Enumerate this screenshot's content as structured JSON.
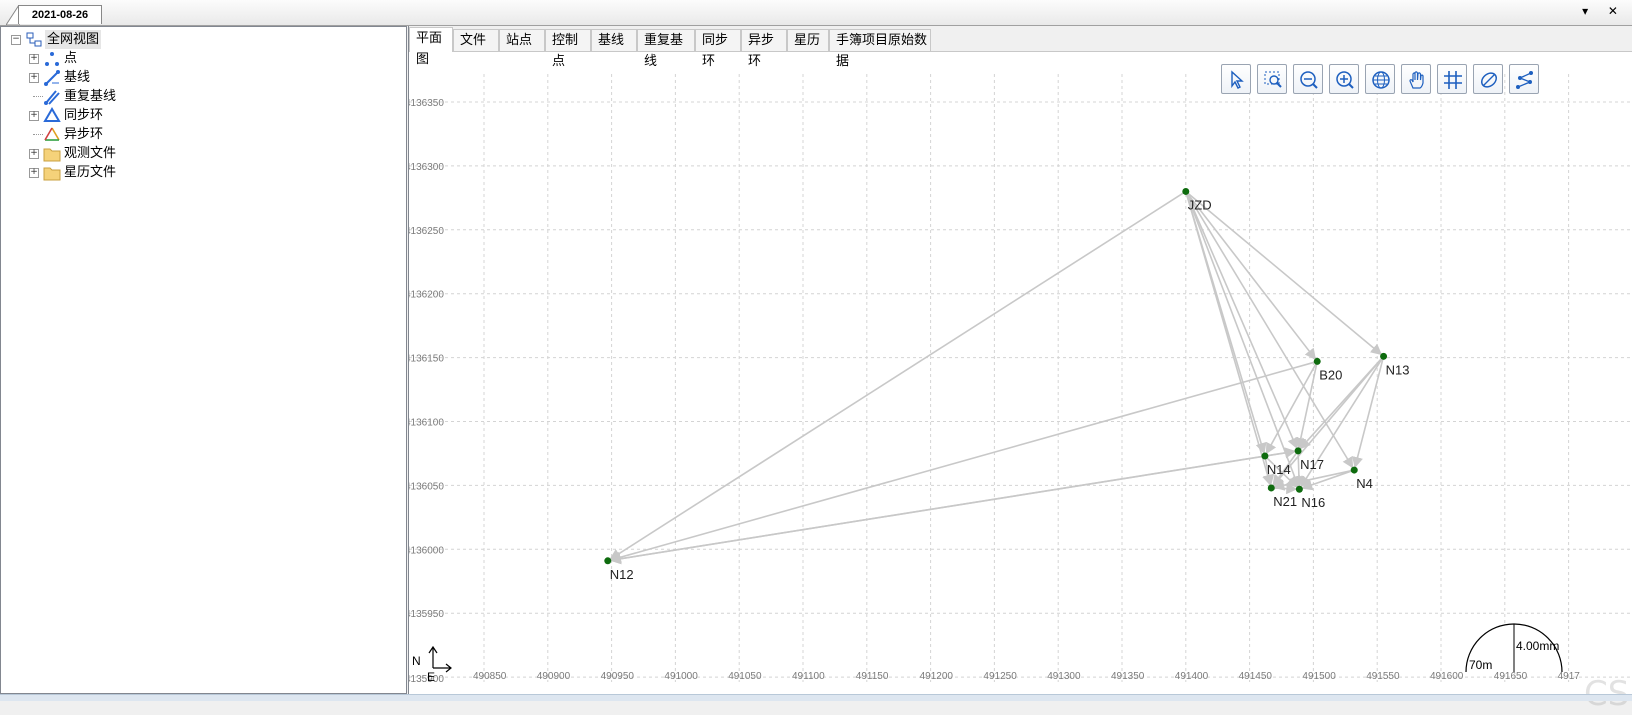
{
  "window": {
    "date_tab": "2021-08-26",
    "controls": "▾ ✕"
  },
  "sidebar": {
    "root_label": "全网视图",
    "items": [
      {
        "label": "点",
        "icon": "points-icon",
        "expandable": true
      },
      {
        "label": "基线",
        "icon": "baseline-icon",
        "expandable": true
      },
      {
        "label": "重复基线",
        "icon": "repeat-baseline-icon",
        "expandable": false
      },
      {
        "label": "同步环",
        "icon": "sync-loop-icon",
        "expandable": true
      },
      {
        "label": "异步环",
        "icon": "async-loop-icon",
        "expandable": false
      },
      {
        "label": "观测文件",
        "icon": "folder-icon",
        "expandable": true
      },
      {
        "label": "星历文件",
        "icon": "folder-icon",
        "expandable": true
      }
    ]
  },
  "tabs": [
    "平面图",
    "文件",
    "站点",
    "控制点",
    "基线",
    "重复基线",
    "同步环",
    "异步环",
    "星历",
    "手簿项目原始数据"
  ],
  "active_tab": "平面图",
  "toolbar": [
    "select-icon",
    "zoom-window-icon",
    "zoom-out-icon",
    "zoom-in-icon",
    "globe-icon",
    "pan-hand-icon",
    "grid-icon",
    "ellipse-icon",
    "network-icon"
  ],
  "map": {
    "x_ticks": [
      "490850",
      "490900",
      "490950",
      "491000",
      "491050",
      "491100",
      "491150",
      "491200",
      "491250",
      "491300",
      "491350",
      "491400",
      "491450",
      "491500",
      "491550",
      "491600",
      "491650",
      "4917"
    ],
    "y_ticks": [
      "4136350",
      "4136300",
      "4136250",
      "4136200",
      "4136150",
      "4136100",
      "4136050",
      "4136000",
      "4135950",
      "4135900"
    ],
    "points": [
      {
        "name": "JZD",
        "x": 491400,
        "y": 4136280
      },
      {
        "name": "N13",
        "x": 491555,
        "y": 4136151
      },
      {
        "name": "B20",
        "x": 491503,
        "y": 4136147
      },
      {
        "name": "N17",
        "x": 491488,
        "y": 4136077
      },
      {
        "name": "N14",
        "x": 491462,
        "y": 4136073
      },
      {
        "name": "N4",
        "x": 491532,
        "y": 4136062
      },
      {
        "name": "N21",
        "x": 491467,
        "y": 4136048
      },
      {
        "name": "N16",
        "x": 491489,
        "y": 4136047
      },
      {
        "name": "N12",
        "x": 490947,
        "y": 4135991
      }
    ],
    "baselines": [
      [
        "JZD",
        "N12"
      ],
      [
        "JZD",
        "N13"
      ],
      [
        "JZD",
        "B20"
      ],
      [
        "JZD",
        "N17"
      ],
      [
        "JZD",
        "N14"
      ],
      [
        "JZD",
        "N4"
      ],
      [
        "JZD",
        "N21"
      ],
      [
        "JZD",
        "N16"
      ],
      [
        "B20",
        "N12"
      ],
      [
        "N14",
        "N12"
      ],
      [
        "N17",
        "N12"
      ],
      [
        "B20",
        "N14"
      ],
      [
        "B20",
        "N17"
      ],
      [
        "N13",
        "N17"
      ],
      [
        "N13",
        "N16"
      ],
      [
        "N13",
        "N4"
      ],
      [
        "N13",
        "N21"
      ],
      [
        "N14",
        "N17"
      ],
      [
        "N14",
        "N21"
      ],
      [
        "N14",
        "N16"
      ],
      [
        "N17",
        "N16"
      ],
      [
        "N17",
        "N21"
      ],
      [
        "N4",
        "N16"
      ],
      [
        "N4",
        "N21"
      ],
      [
        "N21",
        "N16"
      ]
    ],
    "north_label": "N",
    "east_label": "E",
    "scale_mm": "4.00mm",
    "scale_m": "70m"
  },
  "watermark": "CSDN @没事就要敲代码",
  "colors": {
    "point": "#0e6b0e",
    "line": "#c8c8c8",
    "grid": "#d4d4d4",
    "tick": "#7a7a7a"
  }
}
